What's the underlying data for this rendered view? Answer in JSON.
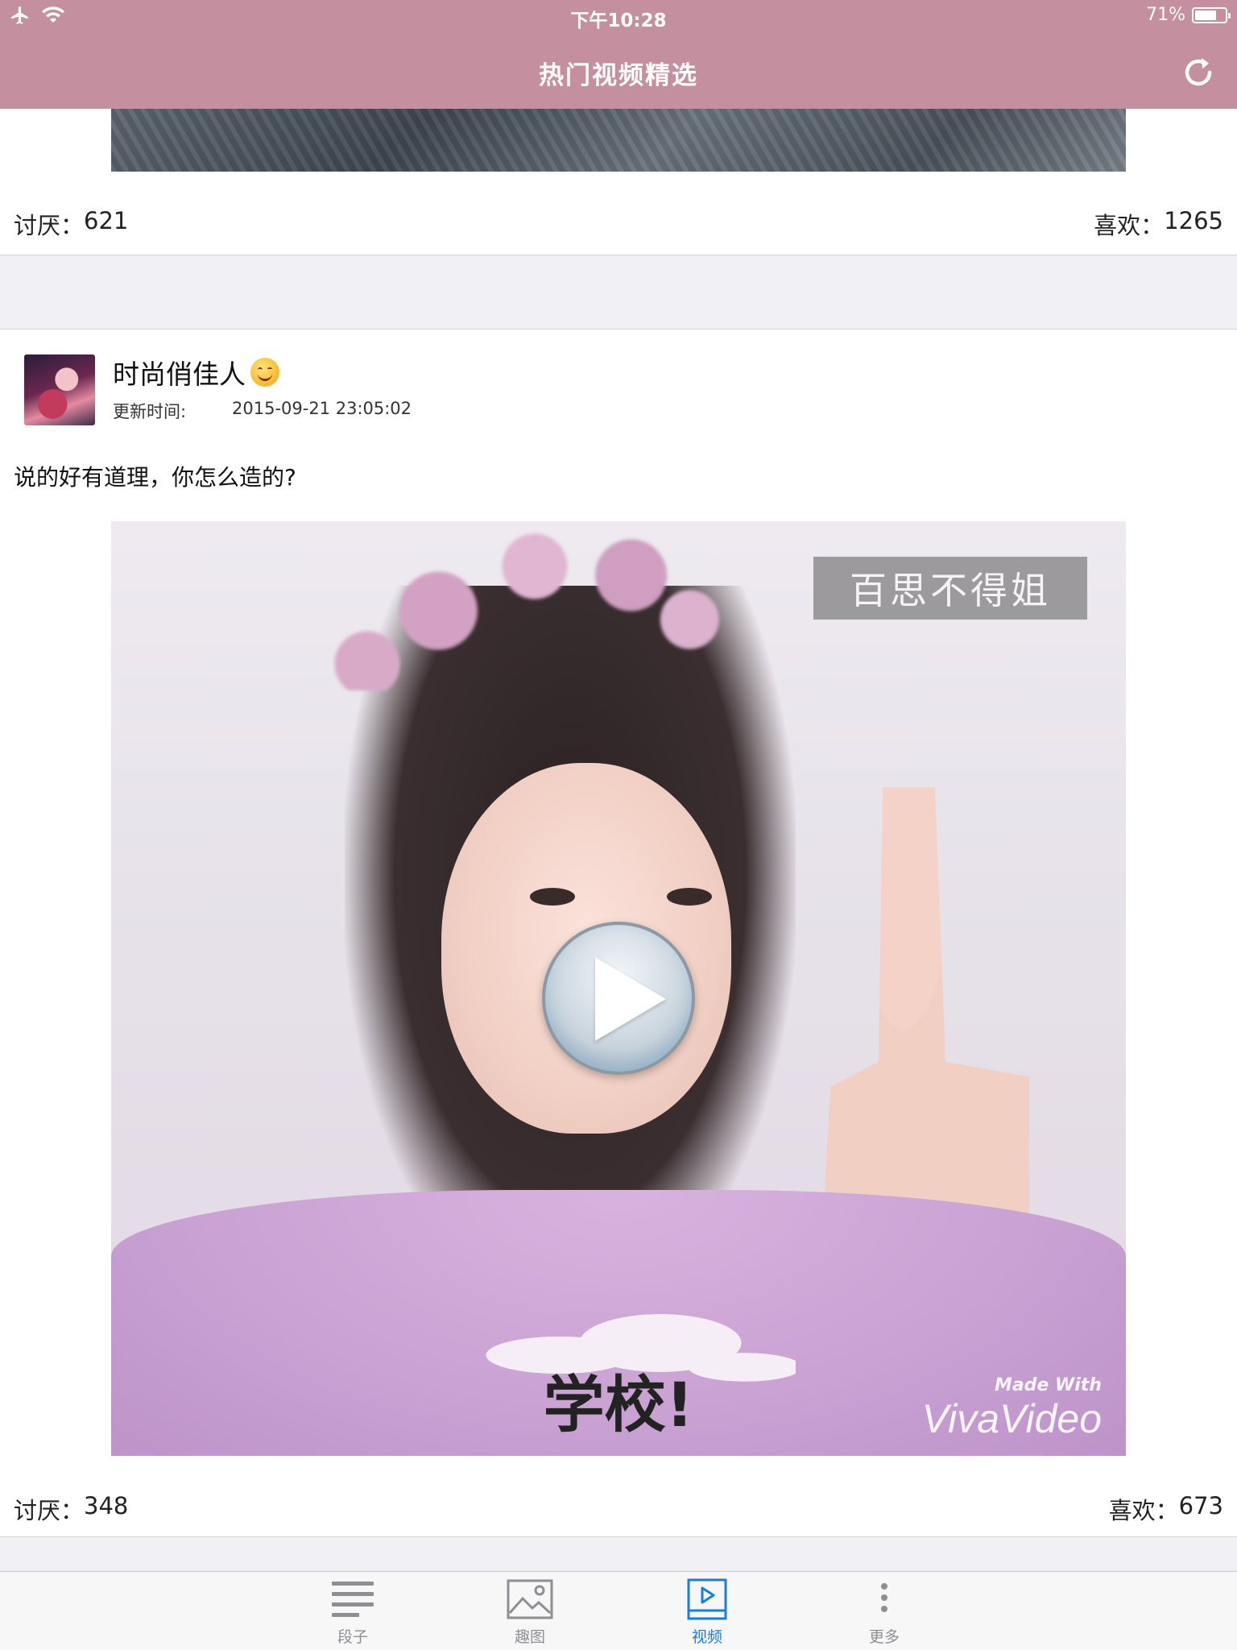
{
  "status_bar": {
    "time": "下午10:28",
    "battery": "71%",
    "battery_level": 0.71
  },
  "nav": {
    "title": "热门视频精选",
    "refresh_icon": "refresh-icon"
  },
  "previous_post": {
    "dislike_label": "讨厌：",
    "dislike_count": "621",
    "like_label": "喜欢：",
    "like_count": "1265"
  },
  "post": {
    "username": "时尚俏佳人",
    "update_label": "更新时间:",
    "update_time": "2015-09-21 23:05:02",
    "text": "说的好有道理，你怎么造的?",
    "video": {
      "watermark": "百思不得姐",
      "caption": "学校!",
      "brand_small": "Made With",
      "brand": "VivaVideo"
    },
    "dislike_label": "讨厌：",
    "dislike_count": "348",
    "like_label": "喜欢：",
    "like_count": "673"
  },
  "tabs": [
    {
      "label": "段子",
      "icon": "list-icon",
      "active": false
    },
    {
      "label": "趣图",
      "icon": "image-icon",
      "active": false
    },
    {
      "label": "视频",
      "icon": "video-icon",
      "active": true
    },
    {
      "label": "更多",
      "icon": "more-icon",
      "active": false
    }
  ],
  "colors": {
    "nav_bg": "#c4909f",
    "active_tab": "#1a7de0",
    "inactive_tab": "#8e8e93",
    "separator": "#efeff4"
  }
}
